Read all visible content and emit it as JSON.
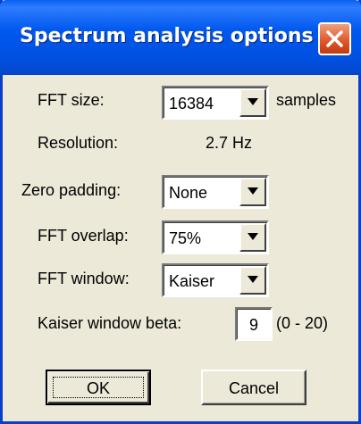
{
  "window": {
    "title": "Spectrum analysis options"
  },
  "fft_size": {
    "label": "FFT size:",
    "value": "16384",
    "unit": "samples"
  },
  "resolution": {
    "label": "Resolution:",
    "value": "2.7 Hz"
  },
  "zero_padding": {
    "label": "Zero padding:",
    "value": "None"
  },
  "fft_overlap": {
    "label": "FFT overlap:",
    "value": "75%"
  },
  "fft_window": {
    "label": "FFT window:",
    "value": "Kaiser"
  },
  "kaiser_beta": {
    "label": "Kaiser window beta:",
    "value": "9",
    "range": "(0 - 20)"
  },
  "buttons": {
    "ok": "OK",
    "cancel": "Cancel"
  },
  "icons": {
    "close": "close-icon",
    "dropdown": "chevron-down-icon"
  },
  "colors": {
    "titlebar": "#0058EE",
    "close_button": "#E05A2C",
    "dialog_bg": "#ECE9D8"
  }
}
